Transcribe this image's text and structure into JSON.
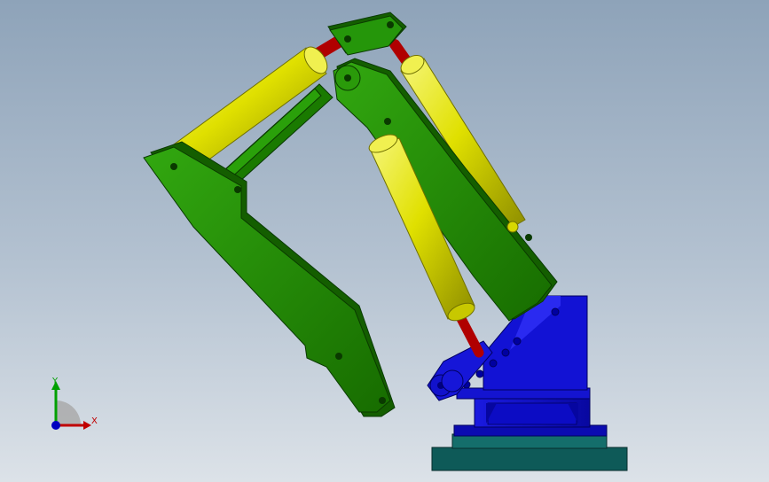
{
  "viewport": {
    "background_top": "#8ea3b9",
    "background_bottom": "#dce2e8"
  },
  "model": {
    "arm_color": "#1f8a00",
    "cylinder_color": "#e0e000",
    "rod_color": "#b00000",
    "base_color": "#1010c8",
    "plate_color": "#0e5a58"
  },
  "triad": {
    "x_label": "X",
    "y_label": "Y",
    "x_color": "#c00000",
    "y_color": "#00a000",
    "z_color": "#0000c0"
  }
}
